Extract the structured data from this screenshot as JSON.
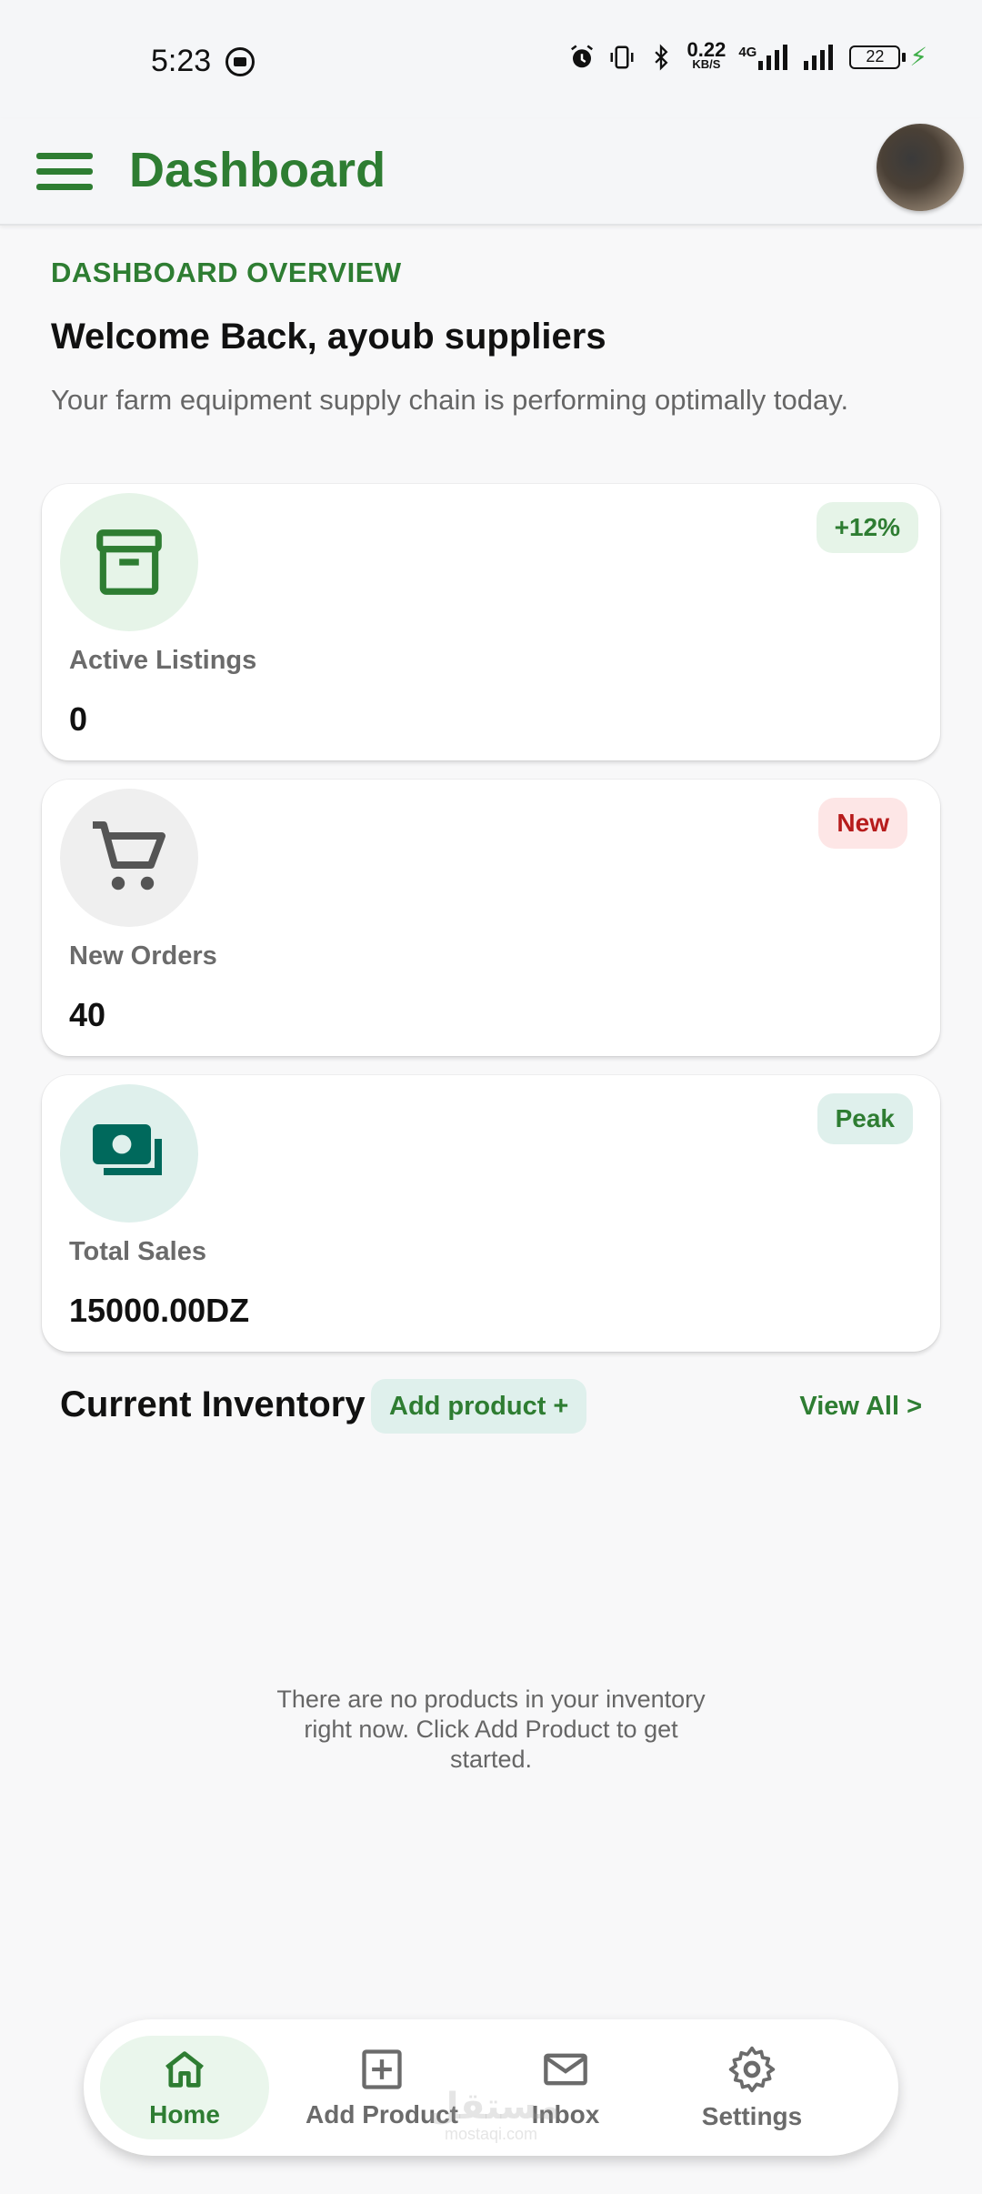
{
  "status_bar": {
    "time": "5:23",
    "network_speed": "0.22",
    "network_unit": "KB/S",
    "network_type": "4G",
    "battery": "22"
  },
  "app_bar": {
    "title": "Dashboard"
  },
  "overview": {
    "label": "DASHBOARD OVERVIEW",
    "welcome": "Welcome Back, ayoub suppliers",
    "subtitle": "Your farm equipment supply chain is performing optimally today."
  },
  "cards": [
    {
      "icon": "archive-icon",
      "label": "Active Listings",
      "value": "0",
      "badge": "+12%",
      "badge_bg": "#e6f4e8",
      "badge_color": "#2e7d32",
      "icon_bg": "#e6f4e8",
      "icon_color": "#2e7d32"
    },
    {
      "icon": "cart-icon",
      "label": "New Orders",
      "value": "40",
      "badge": "New",
      "badge_bg": "#fde6e6",
      "badge_color": "#b71c1c",
      "icon_bg": "#efefef",
      "icon_color": "#555555"
    },
    {
      "icon": "money-icon",
      "label": "Total Sales",
      "value": "15000.00DZ",
      "badge": "Peak",
      "badge_bg": "#dff0ec",
      "badge_color": "#2e7d32",
      "icon_bg": "#dff0ec",
      "icon_color": "#00695c"
    }
  ],
  "inventory": {
    "title": "Current Inventory",
    "add_label": "Add product +",
    "view_all": "View All >",
    "empty_message": "There are no products in your inventory right now. Click Add Product to get started."
  },
  "bottom_nav": {
    "items": [
      {
        "label": "Home",
        "icon": "home-icon",
        "active": true
      },
      {
        "label": "Add Product",
        "icon": "add-box-icon",
        "active": false
      },
      {
        "label": "Inbox",
        "icon": "mail-icon",
        "active": false
      },
      {
        "label": "Settings",
        "icon": "gear-icon",
        "active": false
      }
    ]
  },
  "watermark": {
    "arabic": "مستقل",
    "latin": "mostaqi.com"
  },
  "colors": {
    "primary": "#2e7d32",
    "background": "#f8f8f9"
  }
}
